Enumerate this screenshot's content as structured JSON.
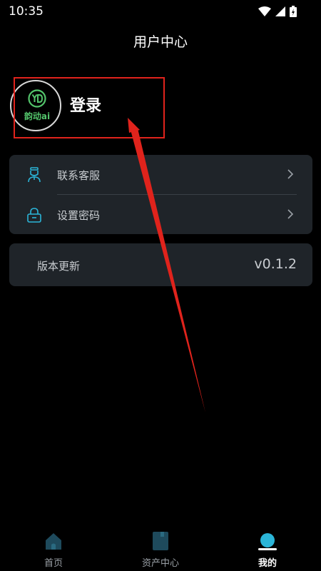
{
  "status_bar": {
    "time": "10:35"
  },
  "header": {
    "title": "用户中心"
  },
  "profile": {
    "logo_text": "韵动ai",
    "login_label": "登录"
  },
  "menu": {
    "items": [
      {
        "label": "联系客服",
        "icon": "customer-service-icon"
      },
      {
        "label": "设置密码",
        "icon": "lock-icon"
      }
    ]
  },
  "version": {
    "label": "版本更新",
    "value": "v0.1.2"
  },
  "tabbar": {
    "items": [
      {
        "label": "首页",
        "icon": "home-icon",
        "active": false
      },
      {
        "label": "资产中心",
        "icon": "asset-book-icon",
        "active": false
      },
      {
        "label": "我的",
        "icon": "profile-dot-icon",
        "active": true
      }
    ]
  },
  "colors": {
    "background": "#000000",
    "card": "#1f2429",
    "accent": "#2bb5d8",
    "annotation": "#e0231c",
    "logo_green": "#53c46b"
  }
}
